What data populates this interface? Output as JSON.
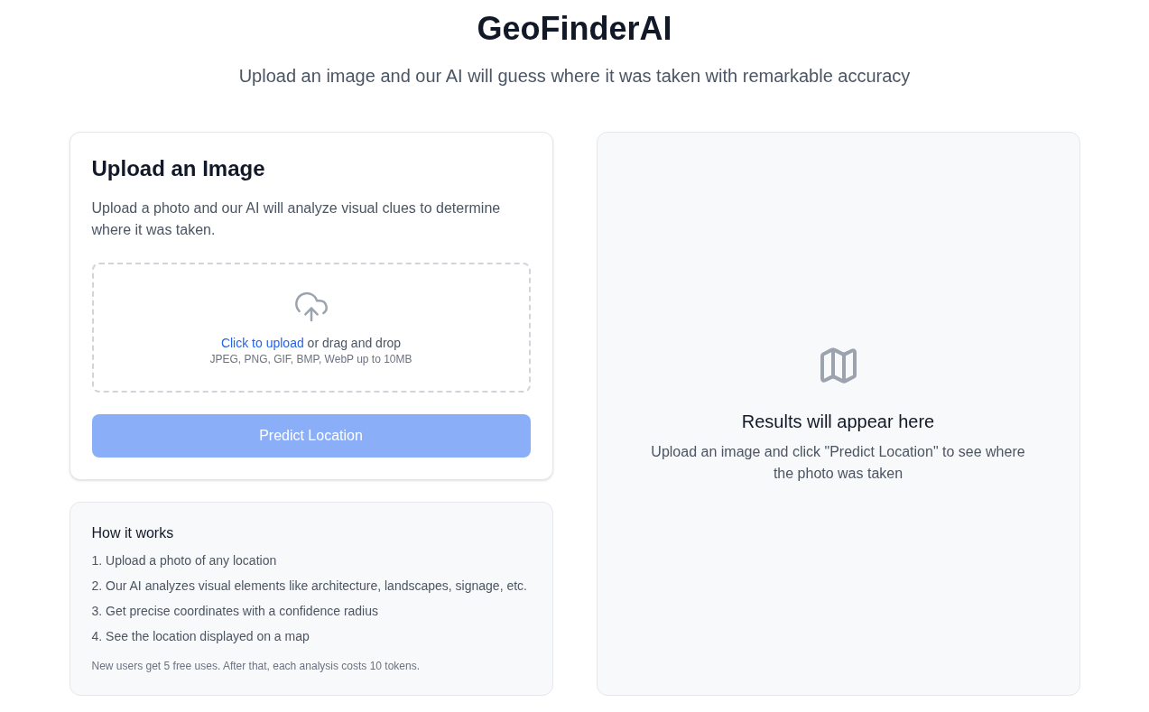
{
  "header": {
    "title": "GeoFinderAI",
    "subtitle": "Upload an image and our AI will guess where it was taken with remarkable accuracy"
  },
  "upload_card": {
    "title": "Upload an Image",
    "description": "Upload a photo and our AI will analyze visual clues to determine where it was taken.",
    "dropzone": {
      "link": "Click to upload",
      "text": "or drag and drop",
      "hint": "JPEG, PNG, GIF, BMP, WebP up to 10MB"
    },
    "button": {
      "label": "Predict Location",
      "disabled": true
    }
  },
  "how_it_works": {
    "title": "How it works",
    "steps": [
      "1. Upload a photo of any location",
      "2. Our AI analyzes visual elements like architecture, landscapes, signage, etc.",
      "3. Get precise coordinates with a confidence radius",
      "4. See the location displayed on a map"
    ],
    "note": "New users get 5 free uses. After that, each analysis costs 10 tokens."
  },
  "results": {
    "title": "Results will appear here",
    "description": "Upload an image and click \"Predict Location\" to see where the photo was taken"
  }
}
